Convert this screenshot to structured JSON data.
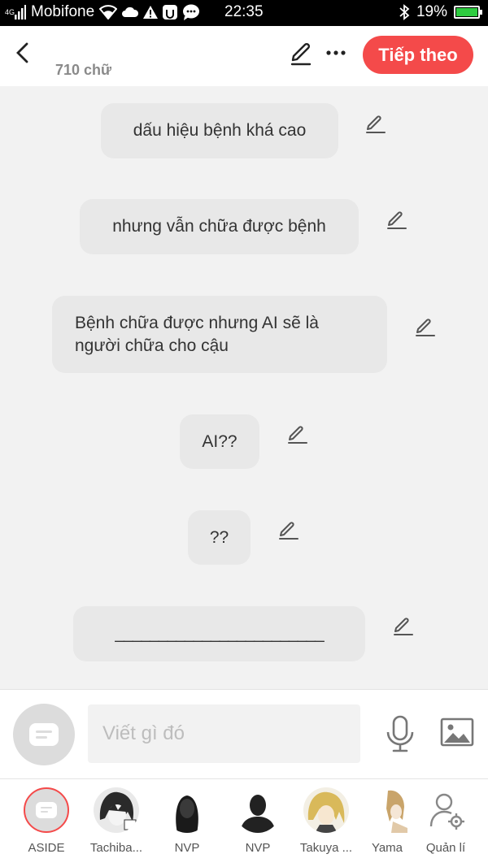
{
  "status_bar": {
    "network": "4G",
    "carrier": "Mobifone",
    "time": "22:35",
    "battery": "19%"
  },
  "header": {
    "word_count": "710 chữ",
    "next_label": "Tiếp theo"
  },
  "messages": [
    "dấu hiệu bệnh khá cao",
    "nhưng vẫn chữa được bệnh",
    "Bệnh chữa được nhưng AI sẽ là người chữa cho cậu",
    "AI??",
    "??",
    "________________________"
  ],
  "composer": {
    "placeholder": "Viết gì đó"
  },
  "characters": [
    {
      "name": "ASIDE"
    },
    {
      "name": "Tachiba..."
    },
    {
      "name": "NVP"
    },
    {
      "name": "NVP"
    },
    {
      "name": "Takuya ..."
    },
    {
      "name": "Yama"
    },
    {
      "name": "Quản lí"
    }
  ],
  "colors": {
    "accent": "#f44a4a",
    "bubble": "#e8e8e8",
    "background": "#f2f2f2"
  }
}
